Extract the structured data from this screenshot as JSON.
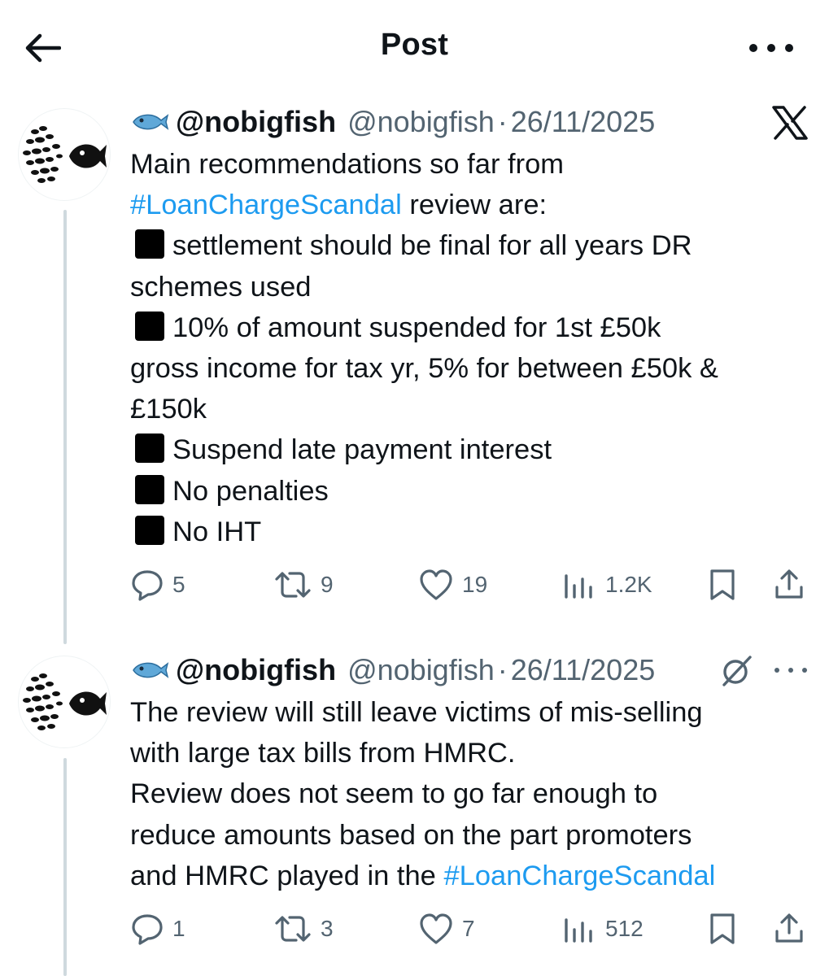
{
  "header": {
    "title": "Post"
  },
  "tweets": [
    {
      "display_name": "@nobigfish",
      "handle": "@nobigfish",
      "separator": "·",
      "date": "26/11/2025",
      "lines": [
        "Main recommendations so far from",
        "review are:",
        "settlement should be final for all years DR",
        "schemes used",
        "10% of amount suspended for 1st £50k",
        "gross income for tax yr, 5% for between £50k &",
        "£150k",
        "Suspend late payment interest",
        "No penalties",
        "No IHT"
      ],
      "hashtag": "#LoanChargeScandal",
      "replies": "5",
      "reposts": "9",
      "likes": "19",
      "views": "1.2K"
    },
    {
      "display_name": "@nobigfish",
      "handle": "@nobigfish",
      "separator": "·",
      "date": "26/11/2025",
      "lines": [
        "The review will still leave victims of mis-selling",
        "with large tax bills from HMRC.",
        "Review does not seem to go far enough to",
        "reduce amounts based on the part promoters",
        "and HMRC played in the"
      ],
      "hashtag": "#LoanChargeScandal",
      "replies": "1",
      "reposts": "3",
      "likes": "7",
      "views": "512"
    }
  ],
  "icons": {
    "back": "back-arrow-icon",
    "more": "more-icon",
    "x_logo": "x-logo-icon",
    "grok": "grok-icon",
    "reply": "reply-icon",
    "repost": "repost-icon",
    "like": "like-icon",
    "views": "views-icon",
    "bookmark": "bookmark-icon",
    "share": "share-icon",
    "bullet": "black-square-emoji",
    "fish": "fish-emoji"
  },
  "colors": {
    "text": "#0f1419",
    "secondary": "#536471",
    "link": "#1d9bf0",
    "thread_line": "#cfd9de"
  }
}
